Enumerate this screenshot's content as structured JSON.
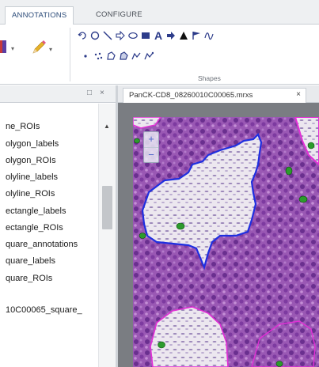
{
  "ribbon": {
    "tabs": [
      {
        "label": "ANNOTATIONS",
        "active": true
      },
      {
        "label": "CONFIGURE",
        "active": false
      }
    ],
    "group_label": "Shapes",
    "shape_tools_row1": [
      "rectangle-dashed-icon",
      "circle-icon",
      "line-icon",
      "arrow-outline-icon",
      "ellipse-icon",
      "square-fill-icon",
      "text-icon",
      "arrow-right-icon",
      "triangle-icon",
      "flag-icon",
      "freehand-icon"
    ],
    "shape_tools_row2": [
      "point-icon",
      "multipoint-icon",
      "polygon-icon",
      "polygon-fill-icon",
      "polyline-icon",
      "polyline2-icon"
    ]
  },
  "left_panel": {
    "items": [
      "ne_ROIs",
      "olygon_labels",
      "olygon_ROIs",
      "olyline_labels",
      "olyline_ROIs",
      "ectangle_labels",
      "ectangle_ROIs",
      "quare_annotations",
      "quare_labels",
      "quare_ROIs",
      "10C00065_square_"
    ],
    "maximize_glyph": "□",
    "close_glyph": "×"
  },
  "document": {
    "tab_label": "PanCK-CD8_08260010C00065.mrxs",
    "tab_close": "×"
  },
  "viewer": {
    "zoom_in": "+",
    "zoom_out": "−"
  },
  "colors": {
    "tissue": "#8e4ea8",
    "roi_outline": "#1f2fe0",
    "roi_outline_magenta": "#e22fd6",
    "marker_green": "#2c9b2c"
  }
}
